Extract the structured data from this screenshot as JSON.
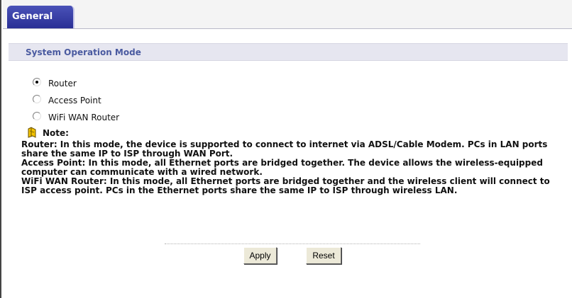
{
  "tabs": [
    {
      "label": "General",
      "active": true
    }
  ],
  "section": {
    "title": "System Operation Mode"
  },
  "modes": [
    {
      "label": "Router",
      "selected": true
    },
    {
      "label": "Access Point",
      "selected": false
    },
    {
      "label": "WiFi WAN Router",
      "selected": false
    }
  ],
  "note": {
    "label": "Note:",
    "icon": "note-icon",
    "router_desc": "Router: In this mode, the device is supported to connect to internet via ADSL/Cable Modem. PCs in LAN ports share the same IP to ISP through WAN Port.",
    "ap_desc": "Access Point: In this mode, all Ethernet ports are bridged together. The device allows the wireless-equipped computer can communicate with a wired network.",
    "wifi_desc": "WiFi WAN Router: In this mode, all Ethernet ports are bridged together and the wireless client will connect to ISP access point. PCs in the Ethernet ports share the same IP to ISP through wireless LAN."
  },
  "buttons": {
    "apply": "Apply",
    "reset": "Reset"
  },
  "colors": {
    "tab_active": "#2a2f95",
    "section_title": "#4a5aa0",
    "section_bg": "#e6e6f0"
  }
}
